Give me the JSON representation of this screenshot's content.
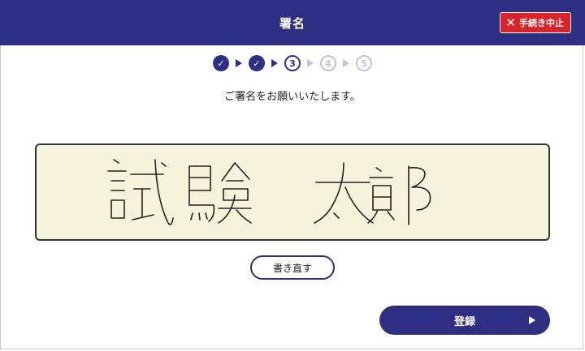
{
  "header": {
    "title": "署名",
    "cancel_label": "手続き中止"
  },
  "steps": [
    {
      "label": "✓",
      "state": "done"
    },
    {
      "label": "✓",
      "state": "done"
    },
    {
      "label": "3",
      "state": "current"
    },
    {
      "label": "4",
      "state": "todo"
    },
    {
      "label": "5",
      "state": "todo"
    }
  ],
  "instruction": "ご署名をお願いいたします。",
  "signature": {
    "text": "試験 太郎"
  },
  "buttons": {
    "rewrite_label": "書き直す",
    "register_label": "登録"
  },
  "colors": {
    "primary": "#2e2f82",
    "danger": "#d9232a",
    "pad_background": "#f6f3dc"
  }
}
